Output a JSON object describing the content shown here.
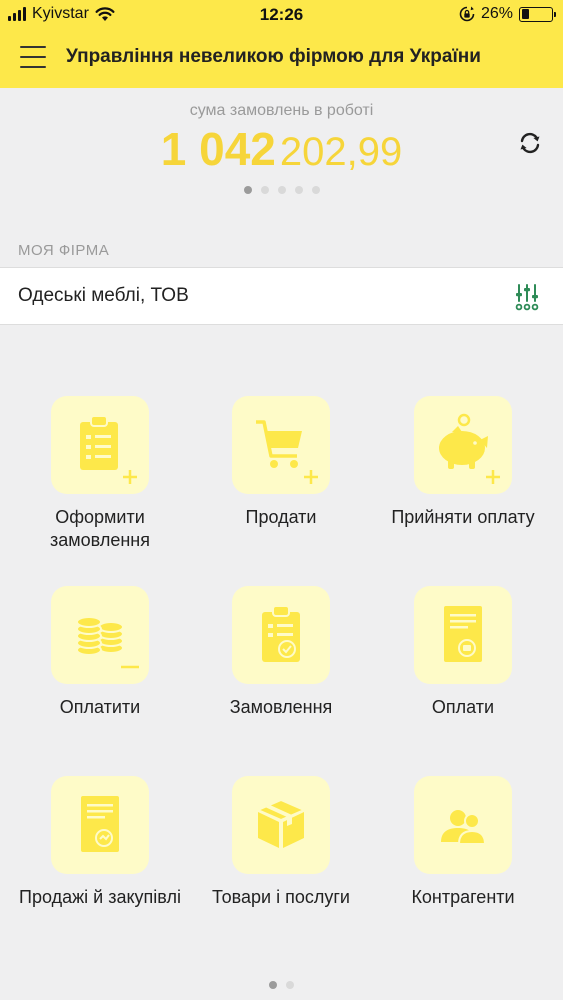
{
  "status_bar": {
    "carrier": "Kyivstar",
    "time": "12:26",
    "battery_percent": "26%",
    "battery_level": 0.26,
    "icons": [
      "signal-icon",
      "wifi-icon",
      "orientation-lock-icon",
      "battery-icon"
    ]
  },
  "app_bar": {
    "title": "Управління невеликою фірмою для України",
    "menu_icon": "hamburger-menu-icon"
  },
  "summary": {
    "label": "сума замовлень в роботі",
    "amount_int": "1 042",
    "amount_dec": "202,99",
    "refresh_icon": "refresh-icon",
    "pager": {
      "total": 5,
      "active": 1
    }
  },
  "firm": {
    "section_label": "МОЯ ФІРМА",
    "name": "Одеські меблі, ТОВ",
    "settings_icon": "sliders-icon"
  },
  "actions": [
    {
      "label": "Оформити замовлення",
      "icon": "clipboard-add-icon"
    },
    {
      "label": "Продати",
      "icon": "cart-add-icon"
    },
    {
      "label": "Прийняти оплату",
      "icon": "piggy-bank-add-icon"
    },
    {
      "label": "Оплатити",
      "icon": "coins-minus-icon"
    },
    {
      "label": "Замовлення",
      "icon": "clipboard-check-icon"
    },
    {
      "label": "Оплати",
      "icon": "payment-document-icon"
    },
    {
      "label": "Продажі й закупівлі",
      "icon": "sales-document-icon"
    },
    {
      "label": "Товари і послуги",
      "icon": "box-icon"
    },
    {
      "label": "Контрагенти",
      "icon": "people-icon"
    }
  ],
  "page_pager": {
    "total": 2,
    "active": 1
  },
  "colors": {
    "accent": "#fde84a",
    "amount": "#f6d53a",
    "icon": "#fde84a",
    "icon_bg": "#fefbc8",
    "settings_icon": "#2e8b57"
  }
}
